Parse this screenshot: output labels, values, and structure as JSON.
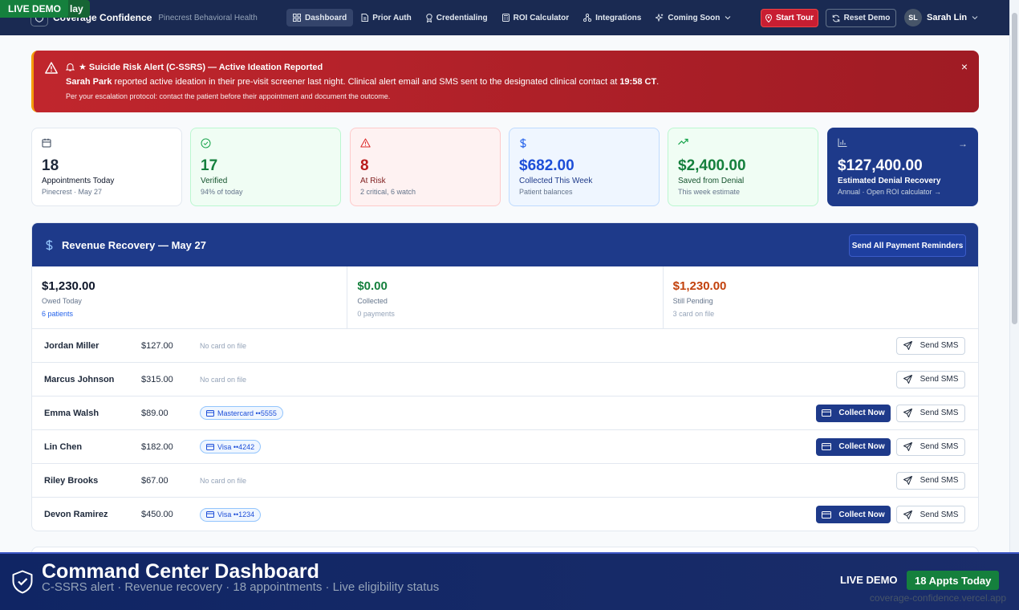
{
  "live_tag": {
    "label": "LIVE DEMO",
    "suffix": "lay"
  },
  "brand": {
    "name": "Coverage Confidence",
    "org": "Pinecrest Behavioral Health"
  },
  "nav": {
    "items": [
      {
        "label": "Dashboard",
        "icon": "grid-icon"
      },
      {
        "label": "Prior Auth",
        "icon": "document-icon"
      },
      {
        "label": "Credentialing",
        "icon": "award-icon"
      },
      {
        "label": "ROI Calculator",
        "icon": "calculator-icon"
      },
      {
        "label": "Integrations",
        "icon": "network-icon"
      },
      {
        "label": "Coming Soon",
        "icon": "sparkle-icon"
      }
    ],
    "start_tour": "Start Tour",
    "reset_demo": "Reset Demo",
    "user_initials": "SL",
    "user_name": "Sarah Lin"
  },
  "alert": {
    "title": "★ Suicide Risk Alert (C-SSRS) — Active Ideation Reported",
    "patient": "Sarah Park",
    "body": " reported active ideation in their pre-visit screener last night. Clinical alert email and SMS sent to the designated clinical contact at ",
    "time": "19:58 CT",
    "end": ".",
    "sub": "Per your escalation protocol: contact the patient before their appointment and document the outcome.",
    "close": "×"
  },
  "stats": [
    {
      "value": "18",
      "label": "Appointments Today",
      "sub": "Pinecrest · May 27",
      "icon": "calendar-icon",
      "color": "#0f172a"
    },
    {
      "value": "17",
      "label": "Verified",
      "sub": "94% of today",
      "icon": "check-circle-icon",
      "color": "#15803d"
    },
    {
      "value": "8",
      "label": "At Risk",
      "sub": "2 critical, 6 watch",
      "icon": "warning-icon",
      "color": "#b91c1c"
    },
    {
      "value": "$682.00",
      "label": "Collected This Week",
      "sub": "Patient balances",
      "icon": "dollar-icon",
      "color": "#1d4ed8"
    },
    {
      "value": "$2,400.00",
      "label": "Saved from Denial",
      "sub": "This week estimate",
      "icon": "trending-up-icon",
      "color": "#15803d"
    },
    {
      "value": "$127,400.00",
      "label": "Estimated Denial Recovery",
      "sub": "Annual · Open ROI calculator →",
      "icon": "bar-chart-icon",
      "color": "#ffffff"
    }
  ],
  "revenue": {
    "title": "Revenue Recovery — May 27",
    "send_all": "Send All Payment Reminders",
    "summary": [
      {
        "value": "$1,230.00",
        "label": "Owed Today",
        "sub": "6 patients",
        "color": "#0f172a"
      },
      {
        "value": "$0.00",
        "label": "Collected",
        "sub": "0 payments",
        "color": "#15803d"
      },
      {
        "value": "$1,230.00",
        "label": "Still Pending",
        "sub": "3 card on file",
        "color": "#c2410c"
      }
    ],
    "rows": [
      {
        "name": "Jordan Miller",
        "amount": "$127.00",
        "card": "No card on file",
        "has_card": false
      },
      {
        "name": "Marcus Johnson",
        "amount": "$315.00",
        "card": "No card on file",
        "has_card": false
      },
      {
        "name": "Emma Walsh",
        "amount": "$89.00",
        "card": "Mastercard ••5555",
        "has_card": true
      },
      {
        "name": "Lin Chen",
        "amount": "$182.00",
        "card": "Visa ••4242",
        "has_card": true
      },
      {
        "name": "Riley Brooks",
        "amount": "$67.00",
        "card": "No card on file",
        "has_card": false
      },
      {
        "name": "Devon Ramirez",
        "amount": "$450.00",
        "card": "Visa ••1234",
        "has_card": true
      }
    ],
    "collect_label": "Collect Now",
    "sms_label": "Send SMS"
  },
  "footer": {
    "title": "Command Center Dashboard",
    "subtitle": "C-SSRS alert · Revenue recovery · 18 appointments · Live eligibility status",
    "live": "LIVE DEMO",
    "badge": "18 Appts Today",
    "url": "coverage-confidence.vercel.app"
  }
}
